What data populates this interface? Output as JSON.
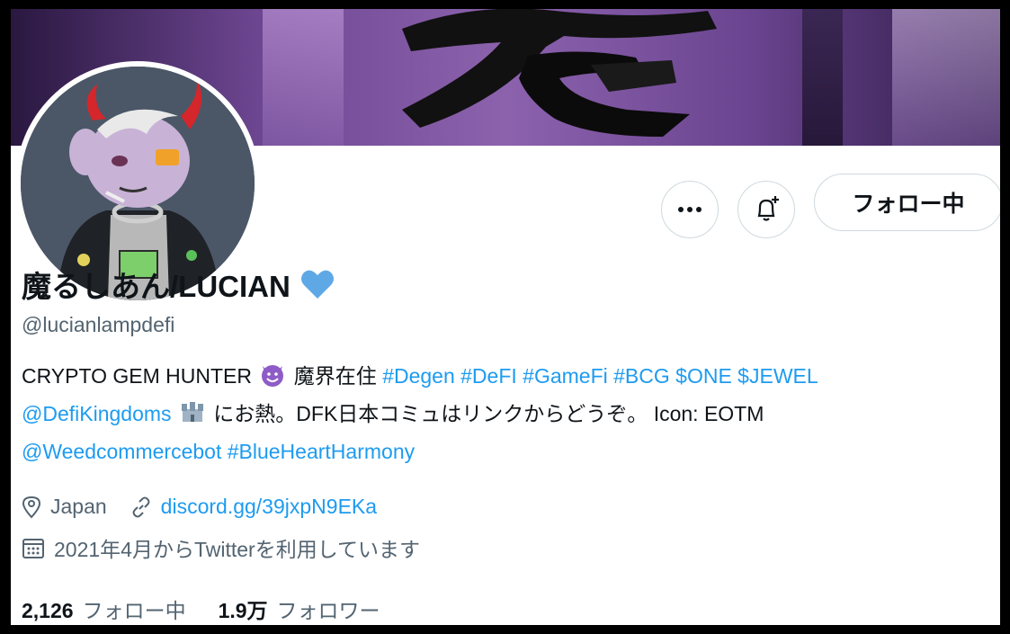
{
  "banner": {
    "kanji": "魔"
  },
  "actions": {
    "more_label": "…",
    "notify_label": "",
    "follow_label": "フォロー中"
  },
  "profile": {
    "display_name": "魔るしあん/LUCIAN",
    "handle": "@lucianlampdefi",
    "verified_emoji": "heart-blue-icon"
  },
  "bio": {
    "line1_text": "CRYPTO GEM HUNTER ",
    "line1_text2": " 魔界在住 ",
    "line1_tags": "#Degen #DeFI #GameFi #BCG $ONE $JEWEL",
    "line2_mention": "@DefiKingdoms",
    "line2_text": " にお熱。DFK日本コミュはリンクからどうぞ。 Icon: EOTM",
    "line3_mention": "@Weedcommercebot",
    "line3_tag": " #BlueHeartHarmony"
  },
  "meta": {
    "location": "Japan",
    "url": "discord.gg/39jxpN9EKa",
    "joined": "2021年4月からTwitterを利用しています"
  },
  "stats": {
    "following_count": "2,126",
    "following_label": "フォロー中",
    "followers_count": "1.9万",
    "followers_label": "フォロワー"
  },
  "colors": {
    "link": "#1d9bf0",
    "text": "#0f1419",
    "secondary": "#536471",
    "border": "#cfd9de"
  }
}
